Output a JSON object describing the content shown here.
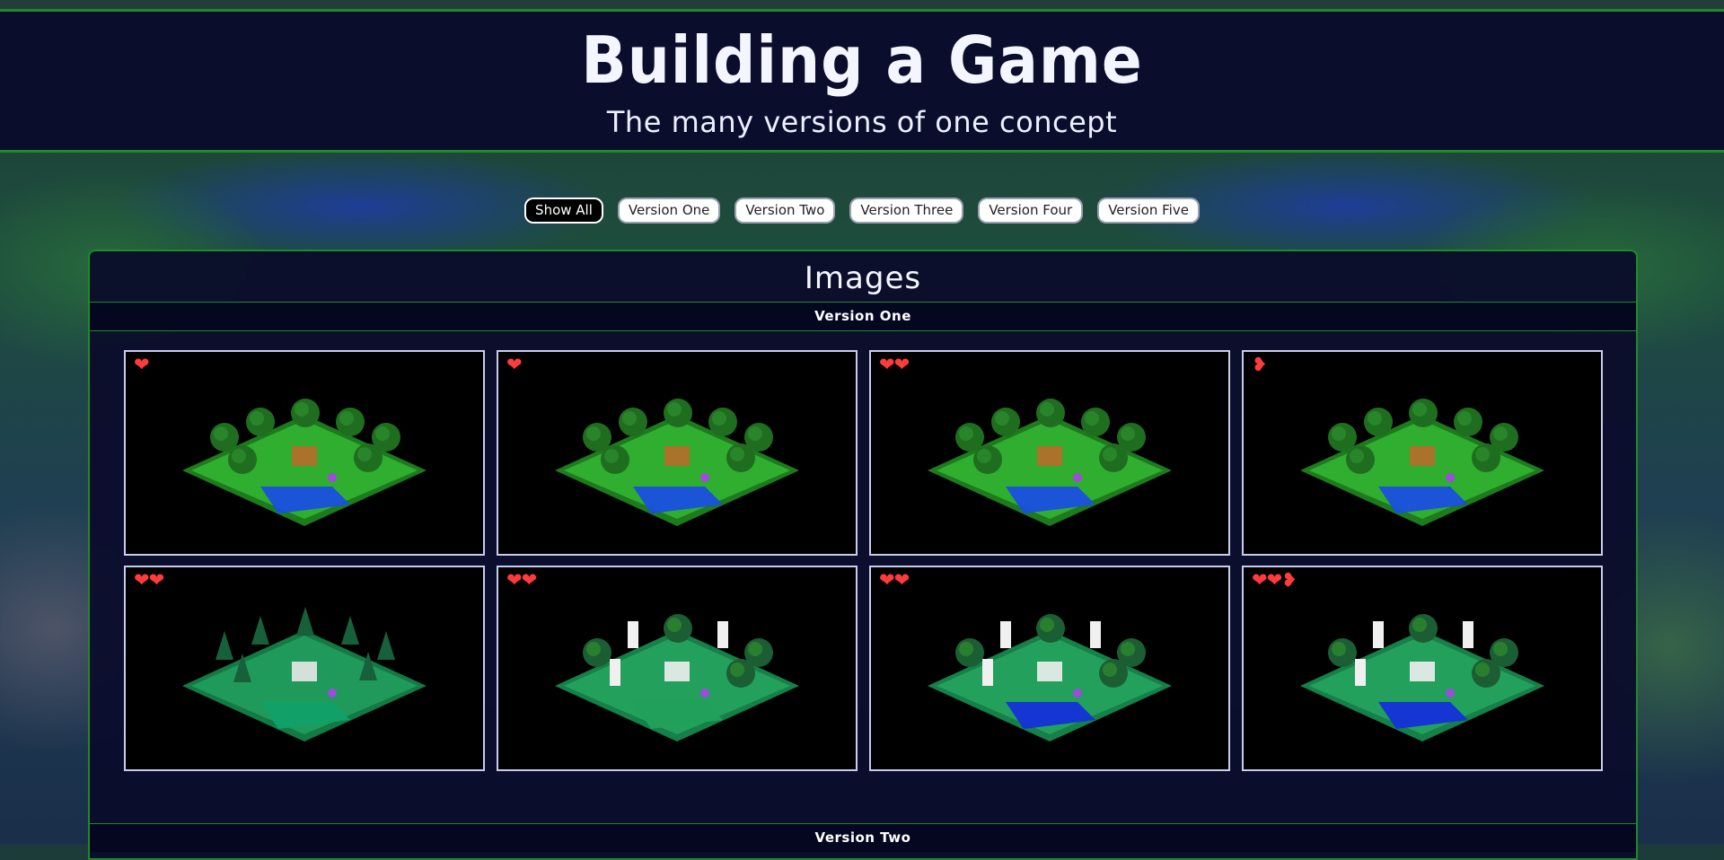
{
  "header": {
    "title": "Building a Game",
    "subtitle": "The many versions of one concept"
  },
  "filters": [
    {
      "label": "Show All",
      "active": true
    },
    {
      "label": "Version One",
      "active": false
    },
    {
      "label": "Version Two",
      "active": false
    },
    {
      "label": "Version Three",
      "active": false
    },
    {
      "label": "Version Four",
      "active": false
    },
    {
      "label": "Version Five",
      "active": false
    }
  ],
  "gallery": {
    "title": "Images",
    "sections": [
      {
        "heading": "Version One",
        "images": [
          {
            "name": "diorama-temple-water",
            "hearts": "❤",
            "theme": "forest"
          },
          {
            "name": "diorama-flower-path",
            "hearts": "❤",
            "theme": "forest"
          },
          {
            "name": "diorama-pond-garden",
            "hearts": "❤❤",
            "theme": "forest"
          },
          {
            "name": "diorama-terrace-cliff",
            "hearts": "❥",
            "theme": "forest"
          },
          {
            "name": "diorama-pine-grove",
            "hearts": "❤❤",
            "theme": "pine"
          },
          {
            "name": "diorama-ruins-field",
            "hearts": "❤❤",
            "theme": "ruins"
          },
          {
            "name": "diorama-ruins-water",
            "hearts": "❤❤",
            "theme": "water"
          },
          {
            "name": "diorama-cliff-water",
            "hearts": "❤❤❥",
            "theme": "water"
          }
        ]
      },
      {
        "heading": "Version Two"
      }
    ]
  },
  "colors": {
    "brand_green": "#1f8a26",
    "panel_bg": "#0a0b2a",
    "heart": "#ff3b3b",
    "card_border": "#c9ccee"
  }
}
